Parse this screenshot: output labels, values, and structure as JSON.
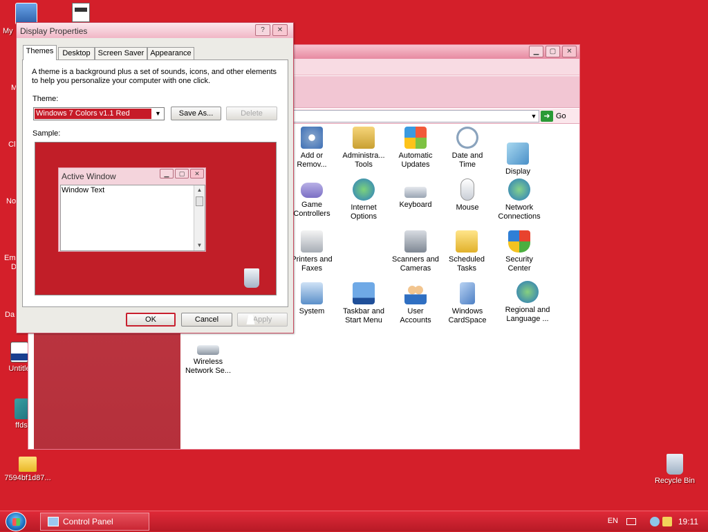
{
  "desktop": {
    "icons": [
      {
        "label": "My",
        "name": "my-computer"
      },
      {
        "label": "Untitle",
        "name": "untitled"
      },
      {
        "label": "ffdsh",
        "name": "ffdsh"
      },
      {
        "label": "7594bf1d87...",
        "name": "folder"
      },
      {
        "label": "Recycle Bin",
        "name": "recycle-bin"
      }
    ],
    "edge_labels": [
      "M",
      "Cl",
      "No",
      "Em",
      "D",
      "Da"
    ]
  },
  "control_panel": {
    "go_label": "Go",
    "items": [
      {
        "line1": "Add or",
        "line2": "Remov..."
      },
      {
        "line1": "Administra...",
        "line2": "Tools"
      },
      {
        "line1": "Automatic",
        "line2": "Updates"
      },
      {
        "line1": "Date and",
        "line2": "Time"
      },
      {
        "line1": "Display",
        "line2": ""
      },
      {
        "line1": "Game",
        "line2": "Controllers"
      },
      {
        "line1": "Internet",
        "line2": "Options"
      },
      {
        "line1": "Keyboard",
        "line2": ""
      },
      {
        "line1": "Mouse",
        "line2": ""
      },
      {
        "line1": "Network",
        "line2": "Connections"
      },
      {
        "line1": "Printers and",
        "line2": "Faxes"
      },
      {
        "line1": "Scanners and",
        "line2": "Cameras"
      },
      {
        "line1": "Scheduled",
        "line2": "Tasks"
      },
      {
        "line1": "Security",
        "line2": "Center"
      },
      {
        "line1": "System",
        "line2": ""
      },
      {
        "line1": "Taskbar and",
        "line2": "Start Menu"
      },
      {
        "line1": "User",
        "line2": "Accounts"
      },
      {
        "line1": "Windows",
        "line2": "CardSpace"
      },
      {
        "line1": "Regional and",
        "line2": "Language ..."
      },
      {
        "line1": "Wireless",
        "line2": "Network Se..."
      }
    ]
  },
  "dialog": {
    "title": "Display Properties",
    "help_btn": "?",
    "close_btn": "✕",
    "tabs": [
      "Themes",
      "Desktop",
      "Screen Saver",
      "Appearance"
    ],
    "description": "A theme is a background plus a set of sounds, icons, and other elements to help you personalize your computer with one click.",
    "theme_label": "Theme:",
    "theme_value": "Windows 7 Colors v1.1 Red",
    "save_as": "Save As...",
    "delete": "Delete",
    "sample_label": "Sample:",
    "sample_window": {
      "title": "Active Window",
      "text": "Window Text"
    },
    "ok": "OK",
    "cancel": "Cancel",
    "apply": "Apply"
  },
  "taskbar": {
    "task_label": "Control Panel",
    "language": "EN",
    "clock": "19:11"
  },
  "colors": {
    "desktop": "#d41f2a",
    "theme_highlight": "#c61b28"
  }
}
